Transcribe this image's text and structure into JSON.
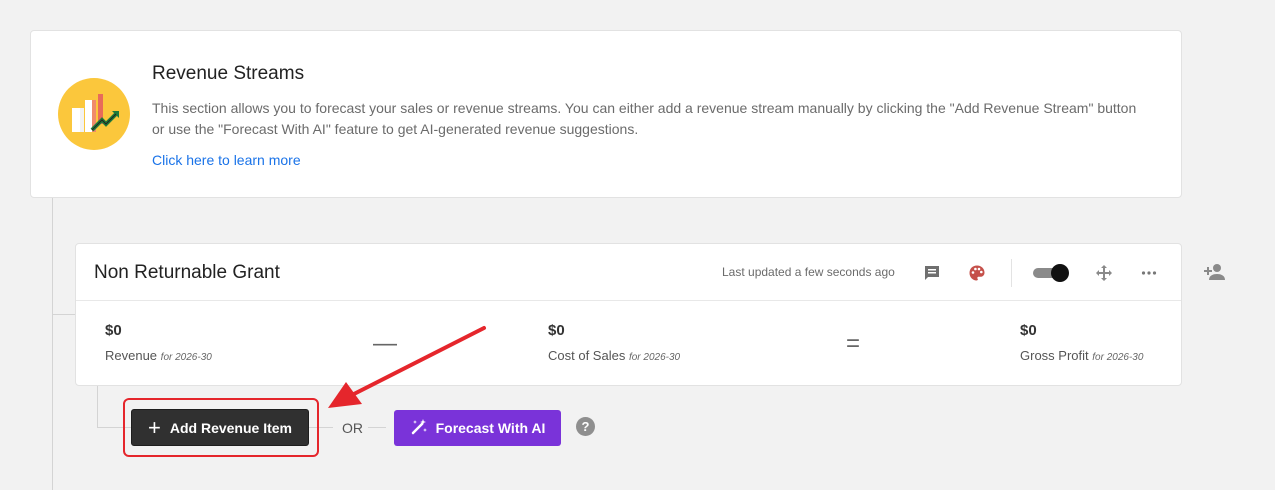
{
  "info": {
    "title": "Revenue Streams",
    "description": "This section allows you to forecast your sales or revenue streams. You can either add a revenue stream manually by clicking the \"Add Revenue Stream\" button or use the \"Forecast With AI\" feature to get AI-generated revenue suggestions.",
    "link": "Click here to learn more",
    "icon": "revenue-chart-icon"
  },
  "grant": {
    "title": "Non Returnable Grant",
    "last_updated": "Last updated a few seconds ago",
    "icons": [
      "comment-icon",
      "palette-icon",
      "toggle-switch",
      "move-icon",
      "more-icon",
      "add-user-icon"
    ],
    "metrics": {
      "revenue": {
        "value": "$0",
        "label": "Revenue",
        "period": "for 2026-30"
      },
      "cost_of_sales": {
        "value": "$0",
        "label": "Cost of Sales",
        "period": "for 2026-30"
      },
      "gross_profit": {
        "value": "$0",
        "label": "Gross Profit",
        "period": "for 2026-30"
      }
    },
    "operators": {
      "minus": "—",
      "equals": "="
    }
  },
  "actions": {
    "add_label": "Add Revenue Item",
    "or_label": "OR",
    "ai_label": "Forecast With AI",
    "help": "?"
  },
  "colors": {
    "link": "#1a73e8",
    "ai_button": "#7a33d9",
    "add_button": "#303030",
    "highlight": "#e5262c",
    "icon_bg": "#fbc73c"
  }
}
